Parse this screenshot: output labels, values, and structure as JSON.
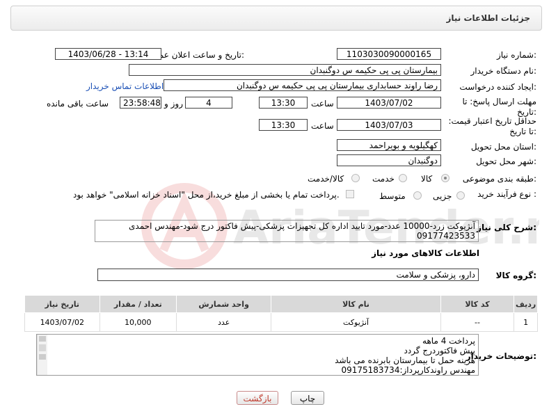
{
  "header": {
    "title": "جزئیات اطلاعات نیاز"
  },
  "form": {
    "need_number_label": "شماره نیاز:",
    "need_number": "1103030090000165",
    "announce_label": "تاریخ و ساعت اعلان عمومی:",
    "announce_value": "1403/06/28 - 13:14",
    "buyer_label": "نام دستگاه خریدار:",
    "buyer_value": "بیمارستان پی پی حکیمه س  دوگنبدان",
    "creator_label": "ایجاد کننده درخواست:",
    "creator_value": "رضا راوند حسابداری بیمارستان پی پی حکیمه س  دوگنبدان",
    "contact_link": "اطلاعات تماس خریدار",
    "deadline_label": "مهلت ارسال پاسخ: تا تاریخ:",
    "deadline_date": "1403/07/02",
    "deadline_time_label": "ساعت",
    "deadline_time": "13:30",
    "days_value": "4",
    "days_label": "روز و",
    "remaining_time": "23:58:48",
    "remaining_label": "ساعت باقی مانده",
    "price_validity_label": "حداقل تاریخ اعتبار قیمت: تا تاریخ:",
    "price_validity_date": "1403/07/03",
    "price_validity_time_label": "ساعت",
    "price_validity_time": "13:30",
    "province_label": "استان محل تحویل:",
    "province_value": "کهگیلویه و بویراحمد",
    "city_label": "شهر محل تحویل:",
    "city_value": "دوگنبدان",
    "category_label": "طبقه بندی موضوعی:",
    "category_options": [
      "کالا",
      "خدمت",
      "کالا/خدمت"
    ],
    "category_selected": "کالا",
    "process_label": "نوع فرآیند خرید :",
    "process_options": [
      "جزیی",
      "متوسط"
    ],
    "process_note": "پرداخت تمام یا بخشی از مبلغ خرید،از محل \"اسناد خزانه اسلامی\" خواهد بود.",
    "description_label": "شرح کلی نیاز:",
    "description_value": "آنژیوکت زرد-10000 عدد-مورد تایید اداره کل تجهیزات پزشکی-پیش فاکتور درج شود-مهندس احمدی 09177423533"
  },
  "goods": {
    "section_title": "اطلاعات کالاهای مورد نیاز",
    "group_label": "گروه کالا:",
    "group_value": "دارو، پزشکی و سلامت",
    "columns": [
      "ردیف",
      "کد کالا",
      "نام کالا",
      "واحد شمارش",
      "تعداد / مقدار",
      "تاریخ نیاز"
    ],
    "rows": [
      {
        "row": "1",
        "code": "--",
        "name": "آنژیوکت",
        "unit": "عدد",
        "qty": "10,000",
        "date": "1403/07/02"
      }
    ]
  },
  "buyer_notes": {
    "label": "توضیحات خریدار:",
    "lines": [
      "پرداخت 4 ماهه",
      "پیش فاکتوردرج گردد",
      "هزینه حمل تا بیمارستان بابرنده می باشد",
      "مهندس راوندکارپرداز:09175183734"
    ]
  },
  "buttons": {
    "print": "چاپ",
    "back": "بازگشت"
  },
  "watermark": {
    "text": "AriaTender.net"
  },
  "colors": {
    "link": "#1a4fb5",
    "table_header": "#d9d9d9",
    "back_button_text": "#c0392b"
  }
}
